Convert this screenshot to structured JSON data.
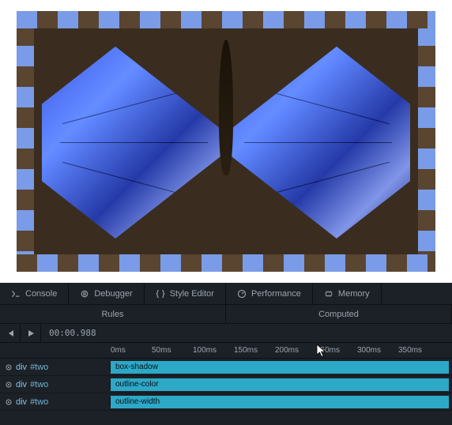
{
  "preview": {
    "element": "div#two"
  },
  "tabs": [
    {
      "icon": "console",
      "label": "Console"
    },
    {
      "icon": "debugger",
      "label": "Debugger"
    },
    {
      "icon": "braces",
      "label": "Style Editor"
    },
    {
      "icon": "gauge",
      "label": "Performance"
    },
    {
      "icon": "memory",
      "label": "Memory"
    }
  ],
  "subtabs": [
    "Rules",
    "Computed"
  ],
  "playback": {
    "time": "00:00.988"
  },
  "ruler": [
    "0ms",
    "50ms",
    "100ms",
    "150ms",
    "200ms",
    "250ms",
    "300ms",
    "350ms"
  ],
  "tracks": [
    {
      "tag": "div",
      "id": "#two",
      "prop": "box-shadow"
    },
    {
      "tag": "div",
      "id": "#two",
      "prop": "outline-color"
    },
    {
      "tag": "div",
      "id": "#two",
      "prop": "outline-width"
    }
  ]
}
